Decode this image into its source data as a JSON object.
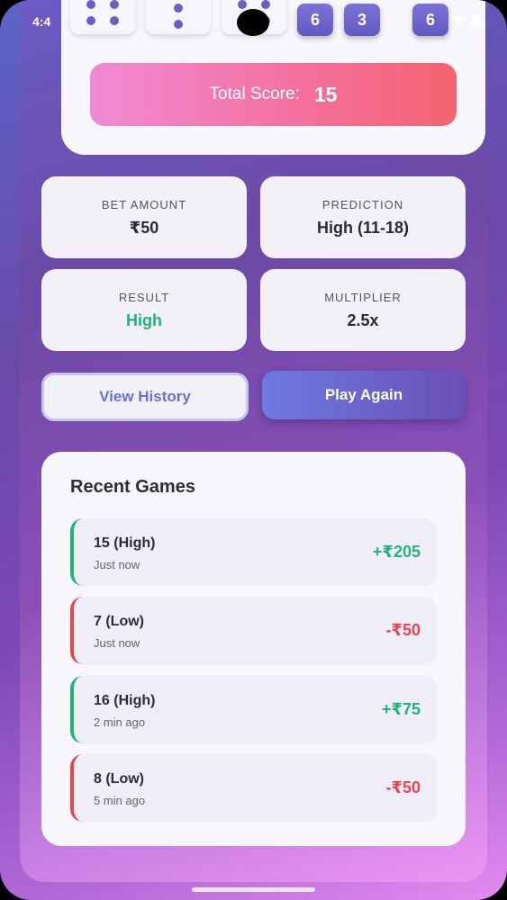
{
  "status": {
    "time": "4:4"
  },
  "dice": {
    "faces": [
      4,
      2,
      4
    ],
    "numbers": [
      "6",
      "3",
      "6"
    ]
  },
  "score": {
    "label": "Total Score:",
    "value": "15"
  },
  "info": {
    "bet": {
      "title": "BET AMOUNT",
      "value": "₹50"
    },
    "prediction": {
      "title": "PREDICTION",
      "value": "High (11-18)"
    },
    "result": {
      "title": "RESULT",
      "value": "High"
    },
    "multiplier": {
      "title": "MULTIPLIER",
      "value": "2.5x"
    }
  },
  "buttons": {
    "history": "View History",
    "play": "Play Again"
  },
  "recent": {
    "title": "Recent Games",
    "games": [
      {
        "score": "15 (High)",
        "time": "Just now",
        "amount": "+₹205",
        "outcome": "win"
      },
      {
        "score": "7 (Low)",
        "time": "Just now",
        "amount": "-₹50",
        "outcome": "loss"
      },
      {
        "score": "16 (High)",
        "time": "2 min ago",
        "amount": "+₹75",
        "outcome": "win"
      },
      {
        "score": "8 (Low)",
        "time": "5 min ago",
        "amount": "-₹50",
        "outcome": "loss"
      }
    ]
  },
  "colors": {
    "win": "#20b37a",
    "loss": "#e2474f",
    "accent": "#6b70d6"
  }
}
